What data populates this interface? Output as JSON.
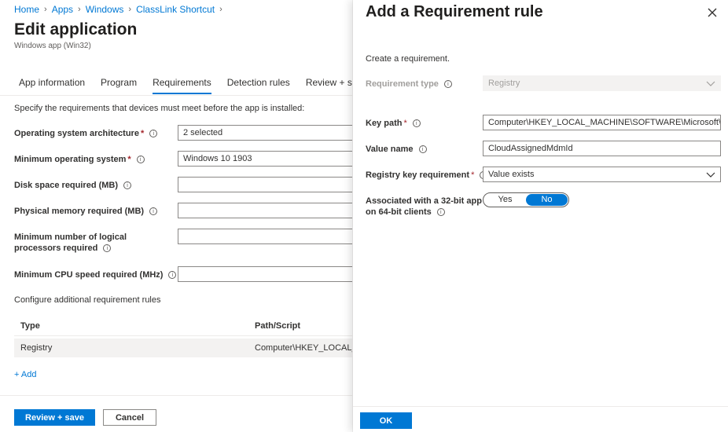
{
  "breadcrumb": [
    "Home",
    "Apps",
    "Windows",
    "ClassLink Shortcut"
  ],
  "page": {
    "title": "Edit application",
    "subtitle": "Windows app (Win32)"
  },
  "tabs": [
    {
      "label": "App information"
    },
    {
      "label": "Program"
    },
    {
      "label": "Requirements",
      "active": true
    },
    {
      "label": "Detection rules"
    },
    {
      "label": "Review + save"
    }
  ],
  "requirements": {
    "intro": "Specify the requirements that devices must meet before the app is installed:",
    "fields": [
      {
        "label": "Operating system architecture",
        "required": true,
        "value": "2 selected"
      },
      {
        "label": "Minimum operating system",
        "required": true,
        "value": "Windows 10 1903"
      },
      {
        "label": "Disk space required (MB)",
        "required": false,
        "value": ""
      },
      {
        "label": "Physical memory required (MB)",
        "required": false,
        "value": ""
      },
      {
        "label": "Minimum number of logical processors required",
        "required": false,
        "value": ""
      },
      {
        "label": "Minimum CPU speed required (MHz)",
        "required": false,
        "value": ""
      }
    ],
    "additional_label": "Configure additional requirement rules",
    "table": {
      "headers": [
        "Type",
        "Path/Script"
      ],
      "rows": [
        [
          "Registry",
          "Computer\\HKEY_LOCAL_MACHINE\\SOFTWARE\\Microsoft\\..."
        ]
      ]
    },
    "add_link": "+ Add"
  },
  "footer": {
    "save_label": "Review + save",
    "cancel_label": "Cancel"
  },
  "pane": {
    "title": "Add a Requirement rule",
    "intro": "Create a requirement.",
    "requirement_type": {
      "label": "Requirement type",
      "value": "Registry"
    },
    "key_path": {
      "label": "Key path",
      "value": "Computer\\HKEY_LOCAL_MACHINE\\SOFTWARE\\Microsoft\\..."
    },
    "value_name": {
      "label": "Value name",
      "value": "CloudAssignedMdmId"
    },
    "key_requirement": {
      "label": "Registry key requirement",
      "value": "Value exists"
    },
    "assoc_32bit": {
      "label_line1": "Associated with a 32-bit app",
      "label_line2": "on 64-bit clients",
      "yes": "Yes",
      "no": "No",
      "selected": "No"
    },
    "ok_label": "OK"
  },
  "icons": {
    "info": "info-icon",
    "close": "close-icon",
    "chevron": "chevron-down-icon",
    "breadcrumb_sep": "chevron-right-icon"
  },
  "colors": {
    "accent": "#0078d4",
    "required": "#a4262c"
  }
}
